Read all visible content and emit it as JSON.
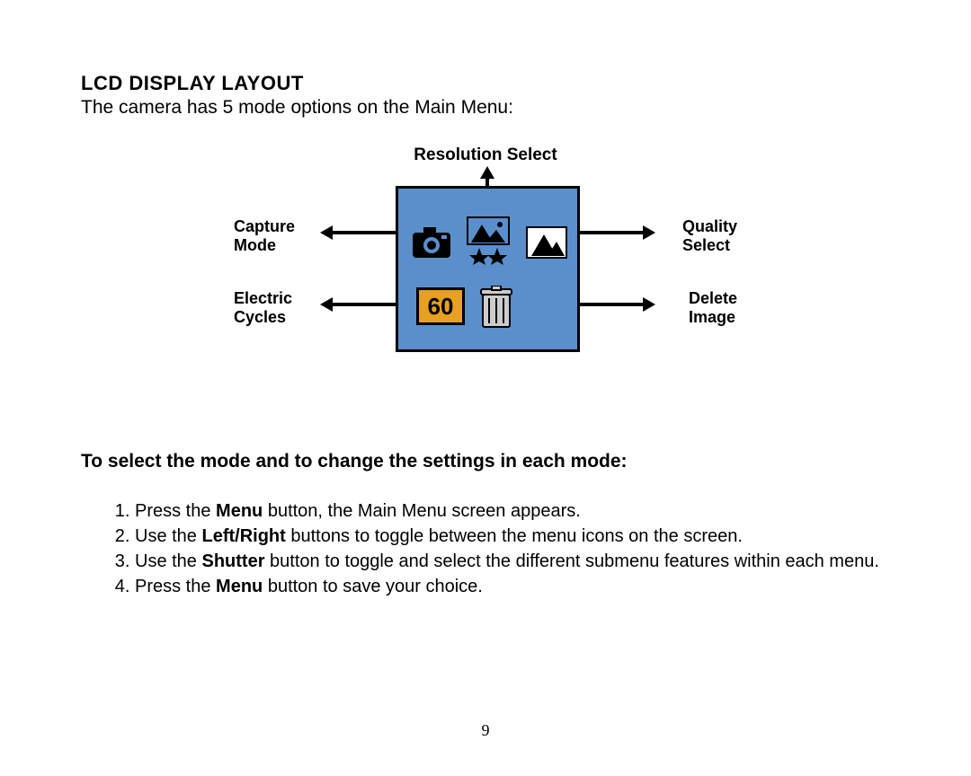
{
  "heading": "LCD DISPLAY LAYOUT",
  "subtext": "The camera has 5 mode options on the Main Menu:",
  "diagram": {
    "top": "Resolution Select",
    "left1a": "Capture",
    "left1b": "Mode",
    "left2a": "Electric",
    "left2b": "Cycles",
    "right1a": "Quality",
    "right1b": "Select",
    "right2a": "Delete",
    "right2b": "Image",
    "cycles_value": "60"
  },
  "instr_heading": "To select the mode and to change the settings in each mode:",
  "steps": {
    "s1a": "Press the ",
    "s1b": "Menu",
    "s1c": " button, the Main Menu screen appears.",
    "s2a": "Use the ",
    "s2b": "Left/Right",
    "s2c": " buttons to toggle between the menu icons on the screen.",
    "s3a": "Use the ",
    "s3b": "Shutter",
    "s3c": " button to toggle and select the different submenu features within each menu.",
    "s4a": "Press the ",
    "s4b": "Menu",
    "s4c": " button to save your choice."
  },
  "page_number": "9"
}
